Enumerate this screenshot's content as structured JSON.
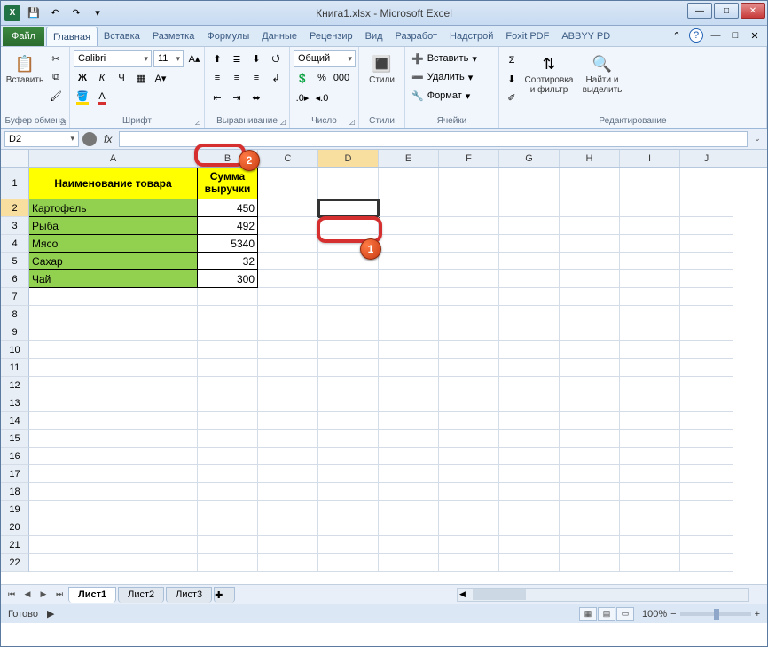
{
  "title": "Книга1.xlsx - Microsoft Excel",
  "qat": {
    "save": "💾",
    "undo": "↶",
    "redo": "↷"
  },
  "win": {
    "min": "—",
    "max": "□",
    "close": "✕"
  },
  "tabs": {
    "file": "Файл",
    "items": [
      "Главная",
      "Вставка",
      "Разметка",
      "Формулы",
      "Данные",
      "Рецензир",
      "Вид",
      "Разработ",
      "Надстрой",
      "Foxit PDF",
      "ABBYY PD"
    ]
  },
  "ribbon": {
    "clipboard": {
      "label": "Буфер обмена",
      "paste": "Вставить"
    },
    "font": {
      "label": "Шрифт",
      "family": "Calibri",
      "size": "11",
      "bold": "Ж",
      "italic": "К",
      "underline": "Ч"
    },
    "align": {
      "label": "Выравнивание"
    },
    "number": {
      "label": "Число",
      "format": "Общий"
    },
    "styles": {
      "label": "Стили",
      "btn": "Стили"
    },
    "cells": {
      "label": "Ячейки",
      "insert": "Вставить",
      "delete": "Удалить",
      "format": "Формат"
    },
    "editing": {
      "label": "Редактирование",
      "sort": "Сортировка\nи фильтр",
      "find": "Найти и\nвыделить"
    }
  },
  "nameBox": "D2",
  "fx": "fx",
  "columns": [
    "A",
    "B",
    "C",
    "D",
    "E",
    "F",
    "G",
    "H",
    "I",
    "J"
  ],
  "headers": {
    "item": "Наименование товара",
    "sum": "Сумма выручки"
  },
  "data": [
    {
      "name": "Картофель",
      "val": "450"
    },
    {
      "name": "Рыба",
      "val": "492"
    },
    {
      "name": "Мясо",
      "val": "5340"
    },
    {
      "name": "Сахар",
      "val": "32"
    },
    {
      "name": "Чай",
      "val": "300"
    }
  ],
  "rowNums": [
    "1",
    "2",
    "3",
    "4",
    "5",
    "6",
    "7",
    "8",
    "9",
    "10",
    "11",
    "12",
    "13",
    "14",
    "15",
    "16",
    "17",
    "18",
    "19",
    "20",
    "21",
    "22"
  ],
  "sheets": {
    "s1": "Лист1",
    "s2": "Лист2",
    "s3": "Лист3"
  },
  "status": "Готово",
  "zoom": "100%",
  "annot": {
    "b1": "1",
    "b2": "2"
  }
}
